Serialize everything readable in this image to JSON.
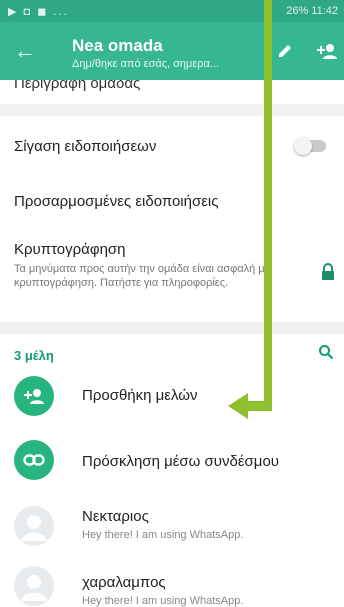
{
  "status_bar": {
    "left_icons": "▶ ◘ ◼ ...",
    "right_text": "26% 11:42"
  },
  "header": {
    "title": "Nea omada",
    "subtitle": "Δημ/θηκε από εσάς, σημερα..."
  },
  "partial_row": "Περιγραφή ομάδας",
  "settings": {
    "mute_label": "Σίγαση ειδοποιήσεων",
    "mute_enabled": false,
    "custom_notifications_label": "Προσαρμοσμένες ειδοποιήσεις",
    "encryption_title": "Κρυπτογράφηση",
    "encryption_desc": "Τα μηνύματα προς αυτήν την ομάδα είναι ασφαλή με κρυπτογράφηση. Πατήστε για πληροφορίες."
  },
  "members": {
    "count_label": "3 μέλη",
    "add_label": "Προσθήκη μελών",
    "invite_label": "Πρόσκληση μέσω συνδέσμου",
    "list": [
      {
        "name": "Νεκταριος",
        "status": "Hey there! I am using WhatsApp."
      },
      {
        "name": "χαραλαμπος",
        "status": "Hey there! I am using WhatsApp."
      }
    ]
  },
  "icons": {
    "back": "arrow-back-icon",
    "edit": "pencil-icon",
    "add_person": "add-person-icon",
    "lock": "lock-icon",
    "search": "search-icon",
    "link": "link-icon",
    "avatar": "person-icon"
  },
  "colors": {
    "header": "#37b692",
    "accent": "#25b57d",
    "annotation": "#8fbf2d"
  }
}
